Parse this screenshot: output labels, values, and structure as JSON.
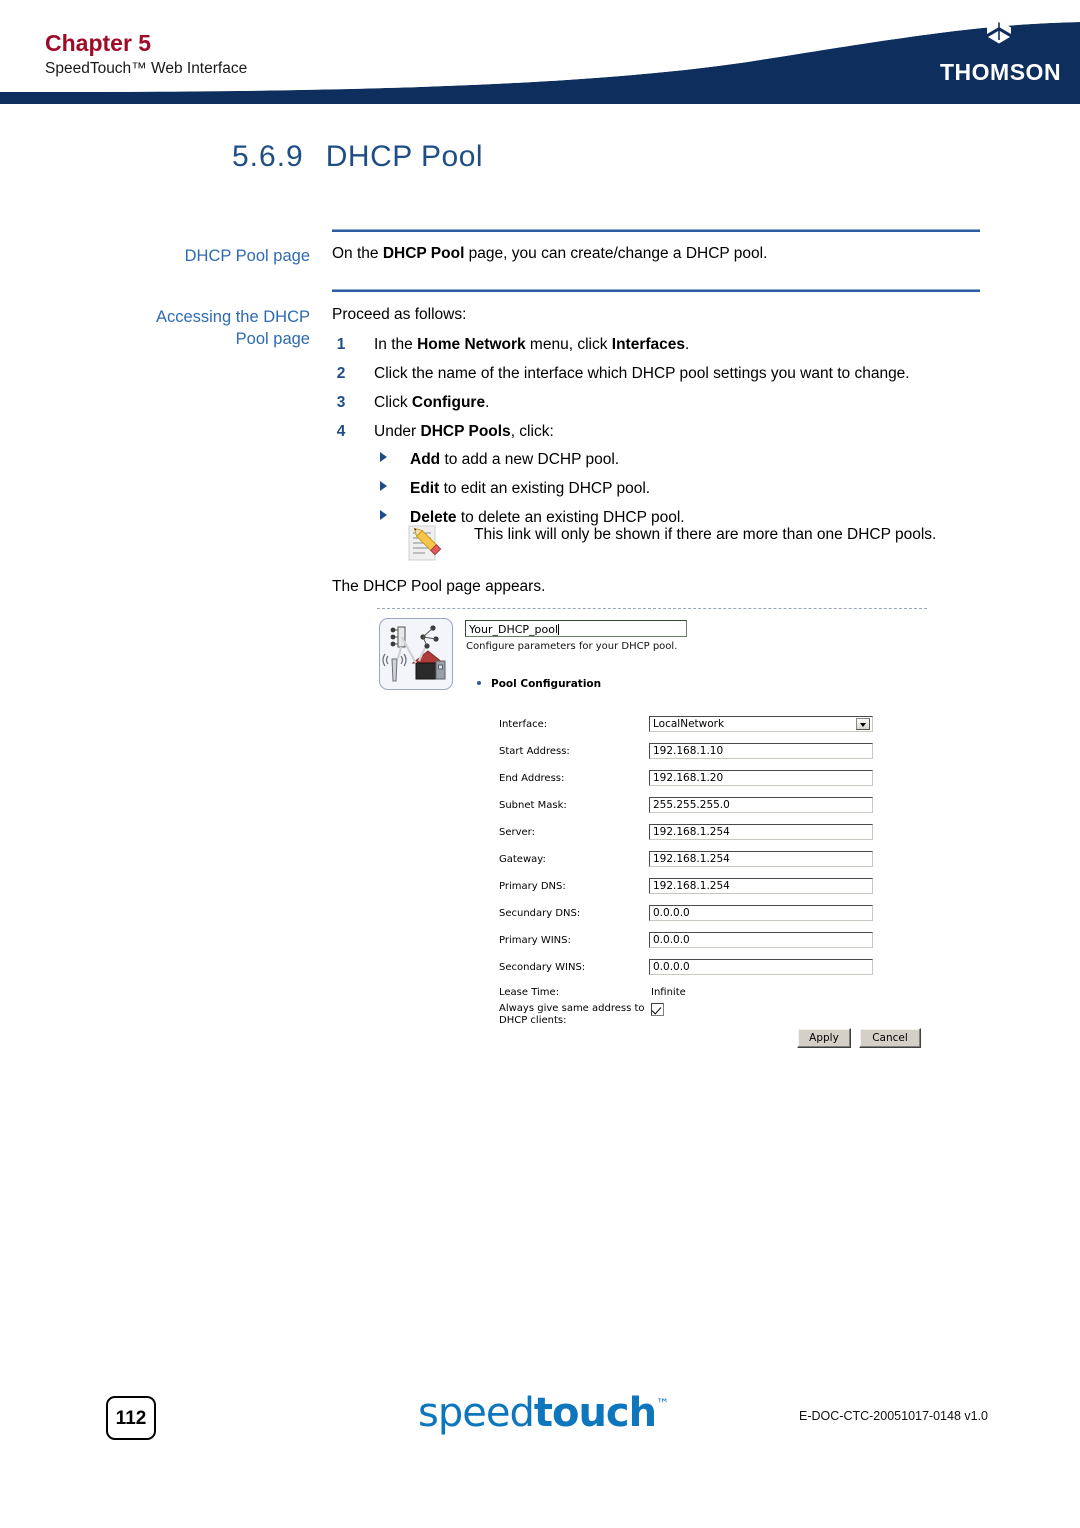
{
  "header": {
    "chapter_label": "Chapter 5",
    "subtitle": "SpeedTouch™ Web Interface",
    "brand": "THOMSON",
    "band_color": "#0E2E5E",
    "chapter_color": "#9E0B28"
  },
  "section": {
    "number": "5.6.9",
    "title": "DHCP Pool",
    "title_color": "#1F4E87"
  },
  "blocks": [
    {
      "side_label": "DHCP Pool page",
      "intro": "On the DHCP Pool page, you can create/change a DHCP pool."
    },
    {
      "side_label_line1": "Accessing the DHCP",
      "side_label_line2": "Pool page",
      "intro": "Proceed as follows:"
    }
  ],
  "steps": [
    {
      "num": "1",
      "text_pre": "In the ",
      "bold1": "Home Network",
      "text_mid": " menu, click ",
      "bold2": "Interfaces",
      "text_post": "."
    },
    {
      "num": "2",
      "text_pre": "Click the name of the interface which DHCP pool settings you want to change.",
      "bold1": "",
      "text_mid": "",
      "bold2": "",
      "text_post": ""
    },
    {
      "num": "3",
      "text_pre": "Click ",
      "bold1": "Configure",
      "text_mid": "",
      "bold2": "",
      "text_post": "."
    },
    {
      "num": "4",
      "text_pre": "Under ",
      "bold1": "DHCP Pools",
      "text_mid": ", click:",
      "bold2": "",
      "text_post": ""
    }
  ],
  "bullets": [
    {
      "bold": "Add",
      "rest": " to add a new DCHP pool."
    },
    {
      "bold": "Edit",
      "rest": " to edit an existing DHCP pool."
    },
    {
      "bold": "Delete",
      "rest": " to delete an existing DHCP pool."
    }
  ],
  "note": {
    "icon": "note-pencil-icon",
    "text": "This link will only be shown if there are more than one DHCP pools."
  },
  "closing_text": "The DHCP Pool page appears.",
  "screenshot": {
    "icon": "home-network-icon",
    "pool_name_value": "Your_DHCP_pool",
    "subtitle": "Configure parameters for your DHCP pool.",
    "section_heading": "Pool Configuration",
    "fields": [
      {
        "label": "Interface:",
        "value": "LocalNetwork",
        "kind": "select"
      },
      {
        "label": "Start Address:",
        "value": "192.168.1.10",
        "kind": "text"
      },
      {
        "label": "End Address:",
        "value": "192.168.1.20",
        "kind": "text"
      },
      {
        "label": "Subnet Mask:",
        "value": "255.255.255.0",
        "kind": "text"
      },
      {
        "label": "Server:",
        "value": "192.168.1.254",
        "kind": "text"
      },
      {
        "label": "Gateway:",
        "value": "192.168.1.254",
        "kind": "text"
      },
      {
        "label": "Primary DNS:",
        "value": "192.168.1.254",
        "kind": "text"
      },
      {
        "label": "Secundary DNS:",
        "value": "0.0.0.0",
        "kind": "text"
      },
      {
        "label": "Primary WINS:",
        "value": "0.0.0.0",
        "kind": "text"
      },
      {
        "label": "Secondary WINS:",
        "value": "0.0.0.0",
        "kind": "text"
      },
      {
        "label": "Lease Time:",
        "value": "Infinite",
        "kind": "plain"
      }
    ],
    "checkbox": {
      "label_line1": "Always give same address to",
      "label_line2": "DHCP clients:",
      "checked": true
    },
    "buttons": {
      "apply": "Apply",
      "cancel": "Cancel"
    }
  },
  "footer": {
    "page_number": "112",
    "logo_light": "speed",
    "logo_bold": "touch",
    "logo_tm": "™",
    "doc_id": "E-DOC-CTC-20051017-0148 v1.0"
  }
}
